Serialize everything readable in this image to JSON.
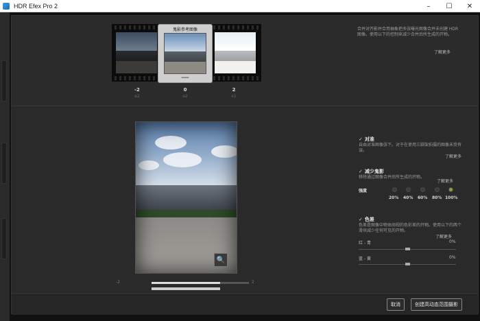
{
  "window": {
    "title": "HDR Efex Pro 2",
    "min": "–",
    "max": "☐",
    "close": "✕"
  },
  "brackets": {
    "selected_label": "鬼影参考图像",
    "items": [
      {
        "ev": "-2",
        "sub": "e2"
      },
      {
        "ev": "0",
        "sub": "e2"
      },
      {
        "ev": "2",
        "sub": "e1"
      }
    ]
  },
  "top_desc": {
    "text": "合并对齐影并合用抽象把多张曝光图像合并未创建 HDR 图像。使用以下的控制来减少合并后所生成的开物。",
    "more": "了解更多"
  },
  "preview": {
    "slider_min": "-2",
    "slider_max": "2",
    "zoom_icon": "🔍"
  },
  "align": {
    "title": "对准",
    "desc": "自由对准图像张下。对于在使用三脚架拍摄的图像未受有误。",
    "more": "了解更多"
  },
  "ghost": {
    "title": "减少鬼影",
    "desc": "移除通过图像合并后所生成的开物。",
    "more": "了解更多",
    "strength_label": "强度",
    "levels": [
      "20%",
      "40%",
      "60%",
      "80%",
      "100%"
    ],
    "selected_index": 4
  },
  "chroma": {
    "title": "色差",
    "desc": "色差是图像中物体阔视的色彩差的开物。使用以下的两个滑块减少任何可见的开物。",
    "more": "了解更多",
    "red_cyan_label": "红 - 青",
    "red_cyan_value": "0%",
    "blue_yellow_label": "蓝 - 黄",
    "blue_yellow_value": "0%"
  },
  "buttons": {
    "cancel": "取消",
    "create": "创建高动态范围摄影"
  }
}
